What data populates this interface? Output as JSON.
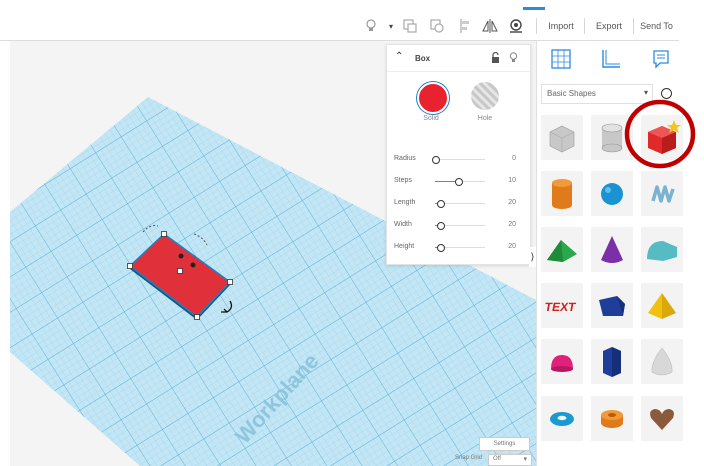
{
  "toolbar": {
    "tools": [
      {
        "icon": "lightbulb-icon",
        "glyph": "💡"
      },
      {
        "icon": "dropdown-arrow-icon",
        "glyph": "▾"
      },
      {
        "icon": "group-icon",
        "glyph": "⬚"
      },
      {
        "icon": "ungroup-icon",
        "glyph": "⧉"
      },
      {
        "icon": "align-icon",
        "glyph": "⫴"
      },
      {
        "icon": "mirror-icon",
        "glyph": "◭"
      },
      {
        "icon": "cruise-icon",
        "glyph": "⊚"
      }
    ]
  },
  "actions": {
    "import_label": "Import",
    "export_label": "Export",
    "sendto_label": "Send To"
  },
  "workplane": {
    "label": "Workplane"
  },
  "inspector": {
    "title": "Box",
    "solid_label": "Solid",
    "hole_label": "Hole",
    "solid_color": "#e8232f",
    "params": [
      {
        "label": "Radius",
        "value": "0",
        "fraction": 0
      },
      {
        "label": "Steps",
        "value": "10",
        "fraction": 0.45
      },
      {
        "label": "Length",
        "value": "20",
        "fraction": 0.1
      },
      {
        "label": "Width",
        "value": "20",
        "fraction": 0.1
      },
      {
        "label": "Height",
        "value": "20",
        "fraction": 0.1
      }
    ]
  },
  "library": {
    "category": "Basic Shapes",
    "tabs": [
      "grid-tab-icon",
      "ruler-tab-icon",
      "notes-tab-icon"
    ],
    "shapes": [
      {
        "name": "box-gray-shape",
        "color": "#c8c8c8"
      },
      {
        "name": "cylinder-gray-shape",
        "color": "#c8c8c8"
      },
      {
        "name": "box-shape",
        "color": "#e02a2a"
      },
      {
        "name": "cylinder-shape",
        "color": "#e07a1a"
      },
      {
        "name": "sphere-shape",
        "color": "#1b92d1"
      },
      {
        "name": "scribble-shape",
        "color": "#7ab3cf"
      },
      {
        "name": "roof-shape",
        "color": "#2aa84a"
      },
      {
        "name": "cone-shape",
        "color": "#7b2fa8"
      },
      {
        "name": "round-roof-shape",
        "color": "#56bcc4"
      },
      {
        "name": "text-shape",
        "color": "#cc2222"
      },
      {
        "name": "polygon-shape",
        "color": "#1f3e9a"
      },
      {
        "name": "pyramid-shape",
        "color": "#f2c10e"
      },
      {
        "name": "half-sphere-shape",
        "color": "#e0207a"
      },
      {
        "name": "hexagonal-prism-shape",
        "color": "#1f3e9a"
      },
      {
        "name": "paraboloid-shape",
        "color": "#d8d8d8"
      },
      {
        "name": "torus-shape",
        "color": "#1b9ad1"
      },
      {
        "name": "tube-shape",
        "color": "#e07a1a"
      },
      {
        "name": "heart-shape",
        "color": "#8b5a3c"
      }
    ]
  },
  "footer": {
    "settings_label": "Settings",
    "snap_label": "Snap Grid",
    "snap_value": "Off"
  },
  "highlight": {
    "color": "#c00000"
  }
}
